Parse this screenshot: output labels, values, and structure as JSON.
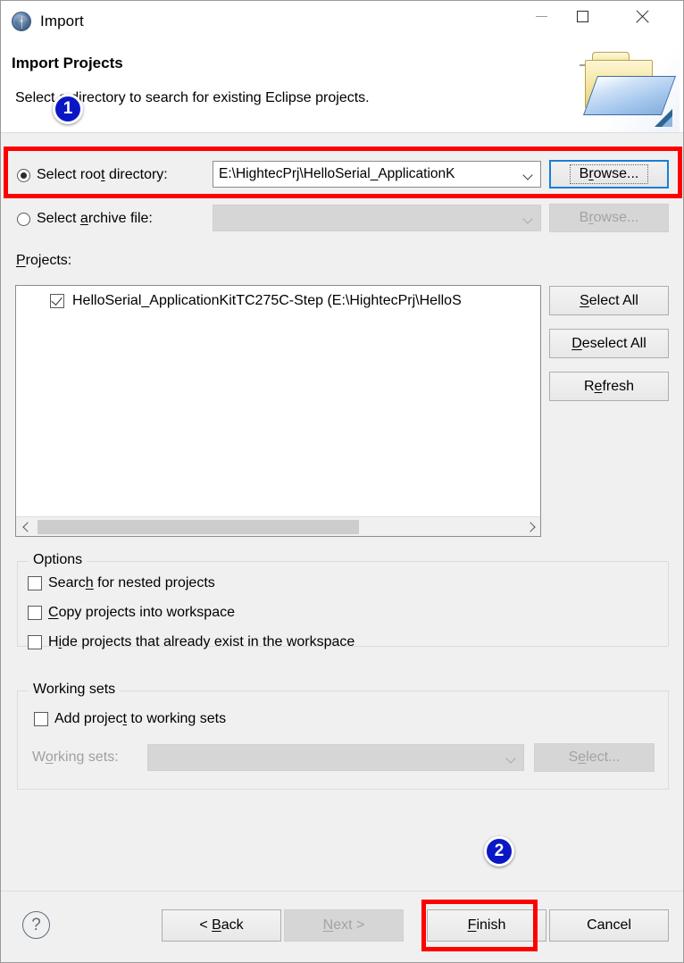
{
  "window": {
    "title": "Import",
    "icon": "eclipse-globe-icon",
    "controls": {
      "minimize": "minimize-icon",
      "maximize": "maximize-icon",
      "close": "close-icon"
    }
  },
  "header": {
    "title": "Import Projects",
    "description": "Select a directory to search for existing Eclipse projects.",
    "art_icon": "import-folder-icon"
  },
  "source": {
    "root_directory": {
      "label": "Select root directory:",
      "selected": true,
      "value": "E:\\HightecPrj\\HelloSerial_ApplicationK",
      "placeholder": "",
      "browse_label": "Browse...",
      "browse_enabled": true
    },
    "archive_file": {
      "label": "Select archive file:",
      "selected": false,
      "value": "",
      "placeholder": "",
      "browse_label": "Browse...",
      "browse_enabled": false
    }
  },
  "projects": {
    "label": "Projects:",
    "items": [
      {
        "checked": true,
        "text": "HelloSerial_ApplicationKitTC275C-Step (E:\\HightecPrj\\HelloS"
      }
    ],
    "buttons": [
      {
        "label": "Select All",
        "mnemonic": "S"
      },
      {
        "label": "Deselect All",
        "mnemonic": "D"
      },
      {
        "label": "Refresh",
        "mnemonic": "e"
      }
    ],
    "scrollbar": {
      "left_arrow": "chevron-left-icon",
      "right_arrow": "chevron-right-icon"
    }
  },
  "options": {
    "title": "Options",
    "items": [
      {
        "label": "Search for nested projects",
        "checked": false
      },
      {
        "label": "Copy projects into workspace",
        "checked": false
      },
      {
        "label": "Hide projects that already exist in the workspace",
        "checked": false
      }
    ]
  },
  "working_sets": {
    "title": "Working sets",
    "add_checkbox": {
      "label": "Add project to working sets",
      "checked": false
    },
    "combo_label": "Working sets:",
    "combo_value": "",
    "combo_enabled": false,
    "select_label": "Select...",
    "select_enabled": false
  },
  "footer": {
    "help_icon": "help-question-icon",
    "buttons": [
      {
        "label": "< Back",
        "enabled": true
      },
      {
        "label": "Next >",
        "enabled": false
      },
      {
        "label": "Finish",
        "enabled": true,
        "highlighted": true
      },
      {
        "label": "Cancel",
        "enabled": true
      }
    ]
  },
  "annotations": {
    "badges": [
      {
        "number": "1",
        "target": "select-root-directory-row"
      },
      {
        "number": "2",
        "target": "finish-button"
      }
    ],
    "highlight_color": "#fe0000",
    "badge_color": "#0b17c4"
  }
}
